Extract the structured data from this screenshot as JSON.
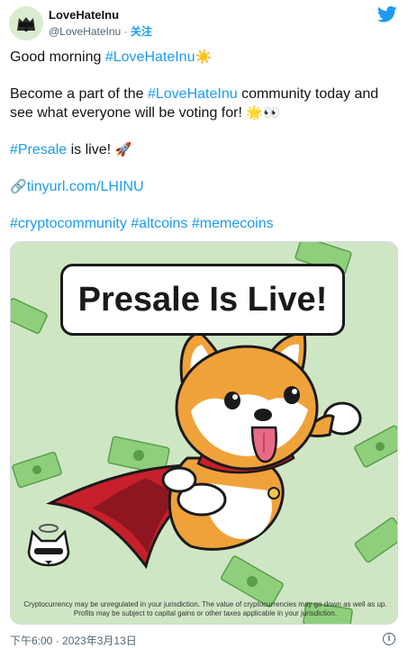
{
  "author": {
    "name": "LoveHateInu",
    "handle": "@LoveHateInu",
    "separator": " · ",
    "follow_label": "关注"
  },
  "tweet": {
    "line1_text": "Good morning ",
    "line1_tag": "#LoveHateInu",
    "line1_emoji": "☀️",
    "line2_text_a": "Become a part of the ",
    "line2_tag": "#LoveHateInu",
    "line2_text_b": " community today and see what everyone will be voting for! ",
    "line2_emoji": "🌟👀",
    "line3_tag": "#Presale",
    "line3_text": " is live! ",
    "line3_emoji": "🚀",
    "link_emoji": "🔗",
    "link_text": "tinyurl.com/LHINU",
    "hashtags": [
      "#cryptocommunity",
      "#altcoins",
      "#memecoins"
    ]
  },
  "media": {
    "banner_text": "Presale Is Live!",
    "disclaimer": "Cryptocurrency may be unregulated in your jurisdiction. The value of cryptocurrencies may go down as well as up. Profits may be subject to capital gains or other taxes applicable in your jurisdiction."
  },
  "footer": {
    "timestamp": "下午6:00 · 2023年3月13日",
    "info_glyph": "i"
  },
  "colors": {
    "link": "#1d9bf0",
    "media_bg": "#cfe6c4",
    "shiba_orange": "#f0a23a",
    "cape_red": "#c8202a"
  },
  "icons": [
    "twitter-bird-icon",
    "info-icon",
    "link-icon",
    "avatar-logo"
  ]
}
